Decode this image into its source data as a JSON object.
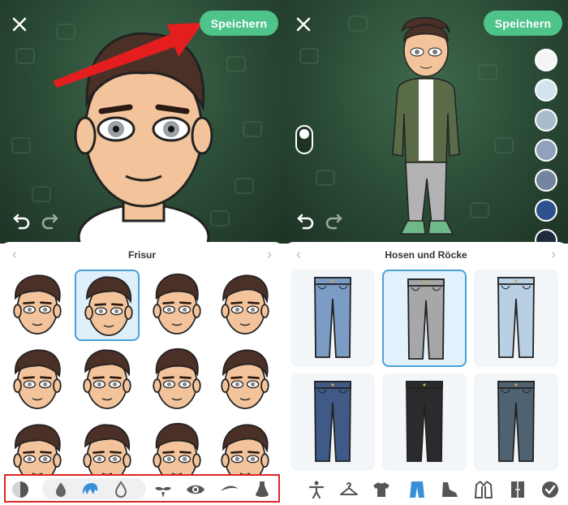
{
  "left_panel": {
    "save_label": "Speichern",
    "section_title": "Frisur",
    "close_icon": "close-icon",
    "undo_icon": "undo-icon",
    "redo_icon": "redo-icon",
    "selected_hairstyle_index": 1,
    "hairstyles_visible": 12,
    "toolbar_icons": [
      "skin-tone-icon",
      "droplet-dark-icon",
      "hair-icon",
      "droplet-light-icon",
      "facial-hair-icon",
      "eye-icon",
      "eyebrow-icon",
      "nose-icon"
    ],
    "highlight_color": "#e02424"
  },
  "right_panel": {
    "save_label": "Speichern",
    "section_title": "Hosen und Röcke",
    "close_icon": "close-icon",
    "undo_icon": "undo-icon",
    "redo_icon": "redo-icon",
    "selected_item_index": 1,
    "pants_colors": [
      "#7b9cc4",
      "#a7a7a9",
      "#b9cfe4",
      "#3f5a86",
      "#2b2b2d",
      "#4f6272"
    ],
    "swatch_colors": [
      "#f5f5f5",
      "#d3e4ef",
      "#a9bccb",
      "#8fa1bc",
      "#74869f",
      "#2f528e",
      "#1f2b3c"
    ],
    "toolbar_icons": [
      "pose-icon",
      "hanger-icon",
      "shirt-icon",
      "pants-icon",
      "shoe-icon",
      "jacket-icon",
      "wardrobe-icon",
      "check-icon"
    ]
  },
  "colors": {
    "accent_green": "#4ec38a",
    "selection_blue": "#4a9fd8",
    "active_tab_blue": "#3a90d6",
    "background_green": "#2a4a35"
  }
}
